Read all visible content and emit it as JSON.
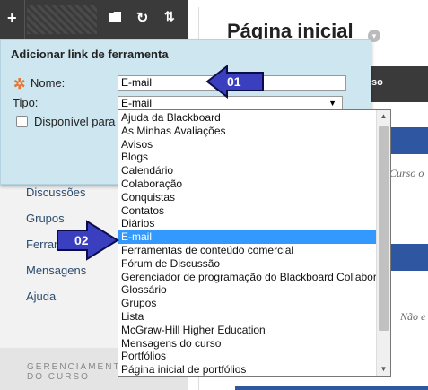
{
  "toolbar": {
    "add_icon": "plus-icon",
    "folder_icon": "folder-icon",
    "refresh_icon": "refresh-icon",
    "sort_icon": "sort-icon"
  },
  "course_menu": {
    "items": [
      "Discussões",
      "Grupos",
      "Ferramentas",
      "Mensagens",
      "Ajuda"
    ],
    "section": "GERENCIAMENTO DO CURSO"
  },
  "main": {
    "title": "Página inicial",
    "header_tab": "so",
    "snippet1": "Curso o",
    "snippet2": "Não e"
  },
  "dialog": {
    "title": "Adicionar link de ferramenta",
    "name_label": "Nome:",
    "name_value": "E-mail",
    "type_label": "Tipo:",
    "type_value": "E-mail",
    "available_label": "Disponível para"
  },
  "dropdown": {
    "options": [
      "Ajuda da Blackboard",
      "As Minhas Avaliações",
      "Avisos",
      "Blogs",
      "Calendário",
      "Colaboração",
      "Conquistas",
      "Contatos",
      "Diários",
      "E-mail",
      "Ferramentas de conteúdo comercial",
      "Fórum de Discussão",
      "Gerenciador de programação do Blackboard Collaborate",
      "Glossário",
      "Grupos",
      "Lista",
      "McGraw-Hill Higher Education",
      "Mensagens do curso",
      "Portfólios",
      "Página inicial de portfólios"
    ],
    "selected_index": 9
  },
  "annotations": {
    "callout1": "01",
    "callout2": "02"
  },
  "colors": {
    "dialog_bg": "#cde6ef",
    "selection": "#3399ff",
    "callout_fill": "#3a3fbf",
    "brand_blue": "#2f56a0"
  }
}
